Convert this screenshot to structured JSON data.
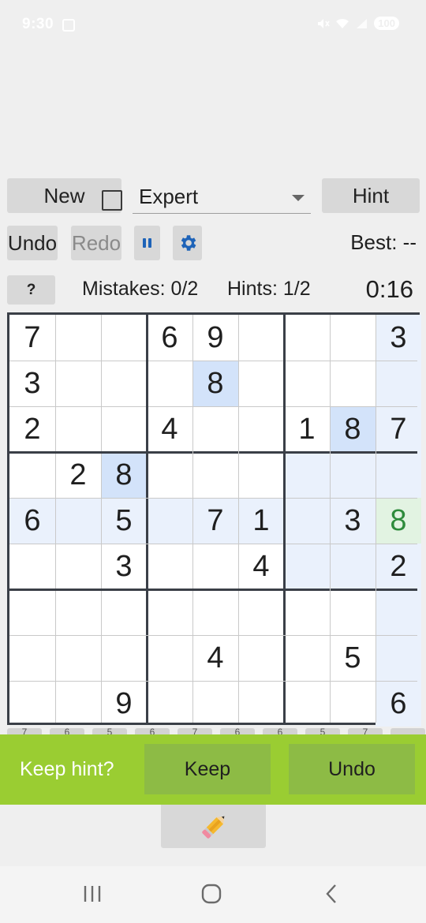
{
  "status_bar": {
    "time": "9:30",
    "battery": "100",
    "icons": [
      "screenshot-icon",
      "mute-icon",
      "wifi-icon",
      "signal-icon"
    ]
  },
  "toolbar": {
    "new_label": "New",
    "difficulty": "Expert",
    "hint_label": "Hint",
    "undo_label": "Undo",
    "redo_label": "Redo",
    "best_text": "Best: --"
  },
  "info": {
    "help_label": "?",
    "mistakes": "Mistakes: 0/2",
    "hints": "Hints: 1/2",
    "timer": "0:16"
  },
  "board": {
    "rows": [
      [
        "7",
        "",
        "",
        "6",
        "9",
        "",
        "",
        "",
        "3"
      ],
      [
        "3",
        "",
        "",
        "",
        "8",
        "",
        "",
        "",
        ""
      ],
      [
        "2",
        "",
        "",
        "4",
        "",
        "",
        "1",
        "8",
        "7"
      ],
      [
        "",
        "2",
        "8",
        "",
        "",
        "",
        "",
        "",
        ""
      ],
      [
        "6",
        "",
        "5",
        "",
        "7",
        "1",
        "",
        "3",
        "8"
      ],
      [
        "",
        "",
        "3",
        "",
        "",
        "4",
        "",
        "",
        "2"
      ],
      [
        "",
        "",
        "",
        "",
        "",
        "",
        "",
        "",
        ""
      ],
      [
        "",
        "",
        "",
        "",
        "4",
        "",
        "",
        "5",
        ""
      ],
      [
        "",
        "",
        "9",
        "",
        "",
        "",
        "",
        "",
        "6"
      ]
    ],
    "highlight_light": [
      [
        0,
        8
      ],
      [
        1,
        8
      ],
      [
        2,
        8
      ],
      [
        3,
        6
      ],
      [
        3,
        7
      ],
      [
        3,
        8
      ],
      [
        4,
        0
      ],
      [
        4,
        1
      ],
      [
        4,
        2
      ],
      [
        4,
        3
      ],
      [
        4,
        4
      ],
      [
        4,
        5
      ],
      [
        4,
        6
      ],
      [
        4,
        7
      ],
      [
        5,
        6
      ],
      [
        5,
        7
      ],
      [
        5,
        8
      ],
      [
        6,
        8
      ],
      [
        7,
        8
      ],
      [
        8,
        8
      ]
    ],
    "highlight_same_value": [
      [
        1,
        4
      ],
      [
        2,
        7
      ],
      [
        3,
        2
      ]
    ],
    "hint_cell": [
      4,
      8
    ],
    "colors": {
      "light": "#eaf1fc",
      "same_value": "#d3e3fa",
      "hint_bg": "#e2f3e2",
      "hint_text": "#2e8b3c"
    }
  },
  "number_strip": [
    "7",
    "6",
    "5",
    "6",
    "7",
    "6",
    "6",
    "5",
    "7",
    ""
  ],
  "snackbar": {
    "message": "Keep hint?",
    "keep_label": "Keep",
    "undo_label": "Undo",
    "color": "#9acd32"
  }
}
